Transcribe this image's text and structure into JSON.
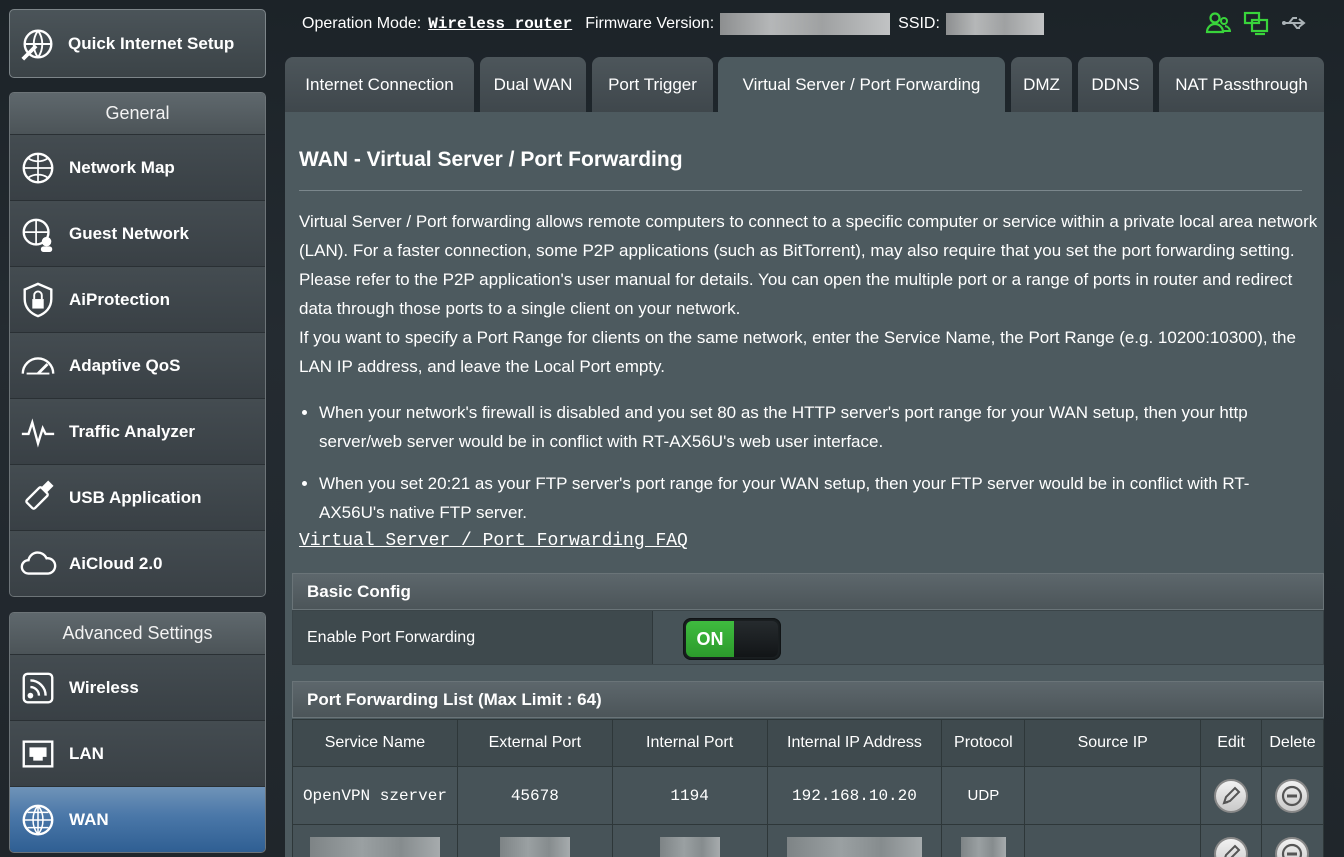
{
  "sidebar": {
    "quick_setup": "Quick Internet Setup",
    "general_header": "General",
    "general_items": [
      {
        "label": "Network Map",
        "icon": "network-map-icon"
      },
      {
        "label": "Guest Network",
        "icon": "guest-network-icon"
      },
      {
        "label": "AiProtection",
        "icon": "aiprotection-shield-icon"
      },
      {
        "label": "Adaptive QoS",
        "icon": "qos-gauge-icon"
      },
      {
        "label": "Traffic Analyzer",
        "icon": "traffic-analyzer-icon"
      },
      {
        "label": "USB Application",
        "icon": "usb-icon"
      },
      {
        "label": "AiCloud 2.0",
        "icon": "cloud-icon"
      }
    ],
    "advanced_header": "Advanced Settings",
    "advanced_items": [
      {
        "label": "Wireless",
        "icon": "wireless-icon"
      },
      {
        "label": "LAN",
        "icon": "lan-port-icon"
      },
      {
        "label": "WAN",
        "icon": "globe-icon",
        "active": true
      }
    ]
  },
  "topbar": {
    "mode_label": "Operation Mode:",
    "mode_value": "Wireless router",
    "firmware_label": "Firmware Version:",
    "ssid_label": "SSID:"
  },
  "status_icons": [
    "users-icon",
    "network-status-icon",
    "usb-status-icon"
  ],
  "tabs": [
    {
      "label": "Internet Connection"
    },
    {
      "label": "Dual WAN"
    },
    {
      "label": "Port Trigger"
    },
    {
      "label": "Virtual Server / Port Forwarding",
      "active": true
    },
    {
      "label": "DMZ"
    },
    {
      "label": "DDNS"
    },
    {
      "label": "NAT Passthrough"
    }
  ],
  "main": {
    "title": "WAN - Virtual Server / Port Forwarding",
    "desc1": "Virtual Server / Port forwarding allows remote computers to connect to a specific computer or service within a private local area network (LAN). For a faster connection, some P2P applications (such as BitTorrent), may also require that you set the port forwarding setting. Please refer to the P2P application's user manual for details. You can open the multiple port or a range of ports in router and redirect data through those ports to a single client on your network.",
    "desc2": "If you want to specify a Port Range for clients on the same network, enter the Service Name, the Port Range (e.g. 10200:10300), the LAN IP address, and leave the Local Port empty.",
    "bullet1": "When your network's firewall is disabled and you set 80 as the HTTP server's port range for your WAN setup, then your http server/web server would be in conflict with RT-AX56U's web user interface.",
    "bullet2": "When you set 20:21 as your FTP server's port range for your WAN setup, then your FTP server would be in conflict with RT-AX56U's native FTP server.",
    "faq_link": "Virtual Server / Port Forwarding FAQ"
  },
  "basic_config": {
    "header": "Basic Config",
    "enable_label": "Enable Port Forwarding",
    "toggle_state": "ON"
  },
  "pf_list": {
    "header": "Port Forwarding List (Max Limit : 64)",
    "columns": [
      "Service Name",
      "External Port",
      "Internal Port",
      "Internal IP Address",
      "Protocol",
      "Source IP",
      "Edit",
      "Delete"
    ],
    "rows": [
      {
        "service": "OpenVPN szerver",
        "external": "45678",
        "internal": "1194",
        "ip": "192.168.10.20",
        "protocol": "UDP",
        "source": ""
      }
    ]
  }
}
